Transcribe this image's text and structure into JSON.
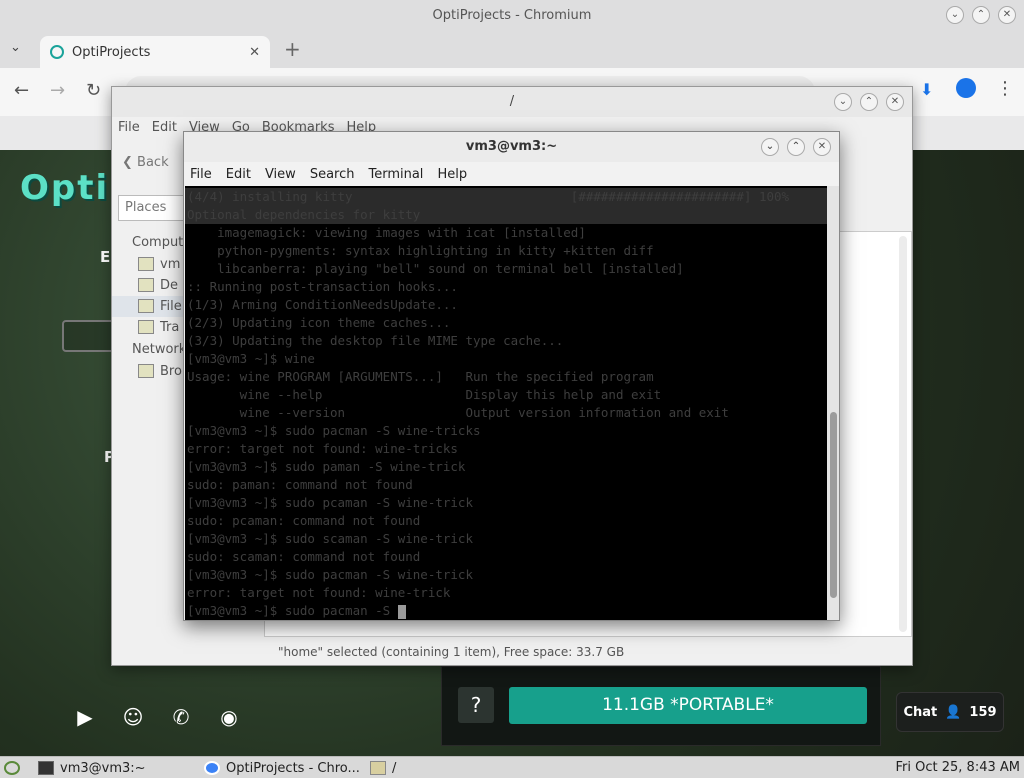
{
  "chrome": {
    "title": "OptiProjects - Chromium",
    "tab_label": "OptiProjects",
    "tab_close": "✕",
    "new_tab": "+",
    "tab_dropdown": "⌄",
    "window_buttons": [
      "⌄",
      "⌃",
      "✕"
    ]
  },
  "site": {
    "logo": "OptiP",
    "letter_e": "E",
    "letter_p": "P",
    "download_button": "11.1GB *PORTABLE*",
    "help_button": "?",
    "chat_label": "Chat",
    "chat_count": "159",
    "social_icons": [
      "youtube-icon",
      "discord-icon",
      "whatsapp-icon",
      "radio-icon"
    ]
  },
  "file_manager": {
    "title": "/",
    "menu": [
      "File",
      "Edit",
      "View",
      "Go",
      "Bookmarks",
      "Help"
    ],
    "back_label": "Back",
    "places_label": "Places",
    "sidebar": [
      {
        "type": "head",
        "label": "Comput"
      },
      {
        "type": "item",
        "label": "vm"
      },
      {
        "type": "item",
        "label": "De"
      },
      {
        "type": "item",
        "label": "File",
        "selected": true
      },
      {
        "type": "item",
        "label": "Tra"
      },
      {
        "type": "head",
        "label": "Network"
      },
      {
        "type": "item",
        "label": "Bro"
      }
    ],
    "status": "\"home\" selected (containing 1 item), Free space: 33.7 GB"
  },
  "terminal": {
    "title": "vm3@vm3:~",
    "menu": [
      "File",
      "Edit",
      "View",
      "Search",
      "Terminal",
      "Help"
    ],
    "lines": [
      {
        "text": "(4/4) installing kitty                             [######################] 100%",
        "hl": true
      },
      {
        "text": "Optional dependencies for kitty",
        "hl": true
      },
      {
        "text": "    imagemagick: viewing images with icat [installed]"
      },
      {
        "text": "    python-pygments: syntax highlighting in kitty +kitten diff"
      },
      {
        "text": "    libcanberra: playing \"bell\" sound on terminal bell [installed]"
      },
      {
        "text": ":: Running post-transaction hooks..."
      },
      {
        "text": "(1/3) Arming ConditionNeedsUpdate..."
      },
      {
        "text": "(2/3) Updating icon theme caches..."
      },
      {
        "text": "(3/3) Updating the desktop file MIME type cache..."
      },
      {
        "text": "[vm3@vm3 ~]$ wine"
      },
      {
        "text": "Usage: wine PROGRAM [ARGUMENTS...]   Run the specified program"
      },
      {
        "text": "       wine --help                   Display this help and exit"
      },
      {
        "text": "       wine --version                Output version information and exit"
      },
      {
        "text": "[vm3@vm3 ~]$ sudo pacman -S wine-tricks"
      },
      {
        "text": "error: target not found: wine-tricks"
      },
      {
        "text": "[vm3@vm3 ~]$ sudo paman -S wine-trick"
      },
      {
        "text": "sudo: paman: command not found"
      },
      {
        "text": "[vm3@vm3 ~]$ sudo pcaman -S wine-trick"
      },
      {
        "text": "sudo: pcaman: command not found"
      },
      {
        "text": "[vm3@vm3 ~]$ sudo scaman -S wine-trick"
      },
      {
        "text": "sudo: scaman: command not found"
      },
      {
        "text": "[vm3@vm3 ~]$ sudo pacman -S wine-trick"
      },
      {
        "text": "error: target not found: wine-trick"
      },
      {
        "text": "[vm3@vm3 ~]$ sudo pacman -S",
        "cursor": true
      }
    ]
  },
  "taskbar": {
    "items": [
      "vm3@vm3:~",
      "OptiProjects - Chro...",
      "/"
    ],
    "clock": "Fri Oct 25,  8:43 AM"
  },
  "colors": {
    "accent": "#17a08c",
    "terminal_bg": "#000000",
    "terminal_fg": "#3e3e3e"
  }
}
